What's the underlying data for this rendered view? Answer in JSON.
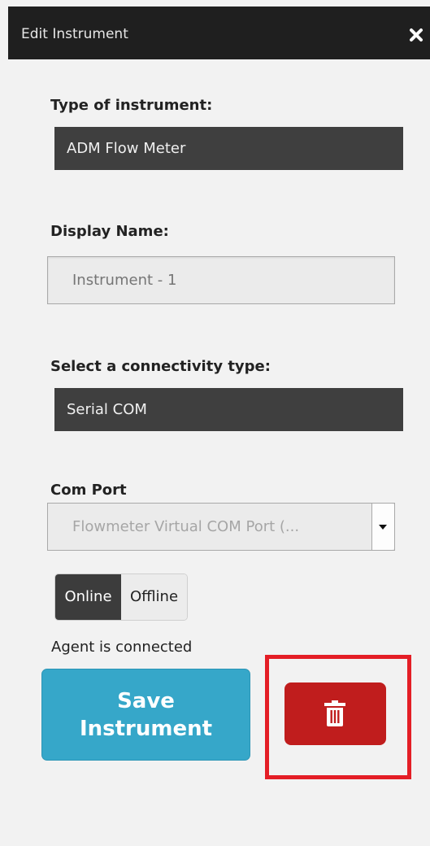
{
  "window": {
    "title": "Edit Instrument",
    "close_icon": "close-icon"
  },
  "form": {
    "type_label": "Type of instrument:",
    "type_value": "ADM Flow Meter",
    "display_name_label": "Display Name:",
    "display_name_placeholder": "Instrument - 1",
    "display_name_value": "",
    "connectivity_label": "Select a connectivity type:",
    "connectivity_value": "Serial COM",
    "com_port_label": "Com Port",
    "com_port_value": "Flowmeter Virtual COM Port (...",
    "toggle": {
      "online_label": "Online",
      "offline_label": "Offline",
      "selected": "Online"
    },
    "status_text": "Agent is connected"
  },
  "actions": {
    "save_line1": "Save",
    "save_line2": "Instrument",
    "delete_icon": "trash-icon"
  },
  "colors": {
    "titlebar": "#1f1f1f",
    "dark_field": "#3f3f3f",
    "save_button": "#36a7c9",
    "delete_button": "#c01d1d",
    "highlight": "#e41e26"
  }
}
